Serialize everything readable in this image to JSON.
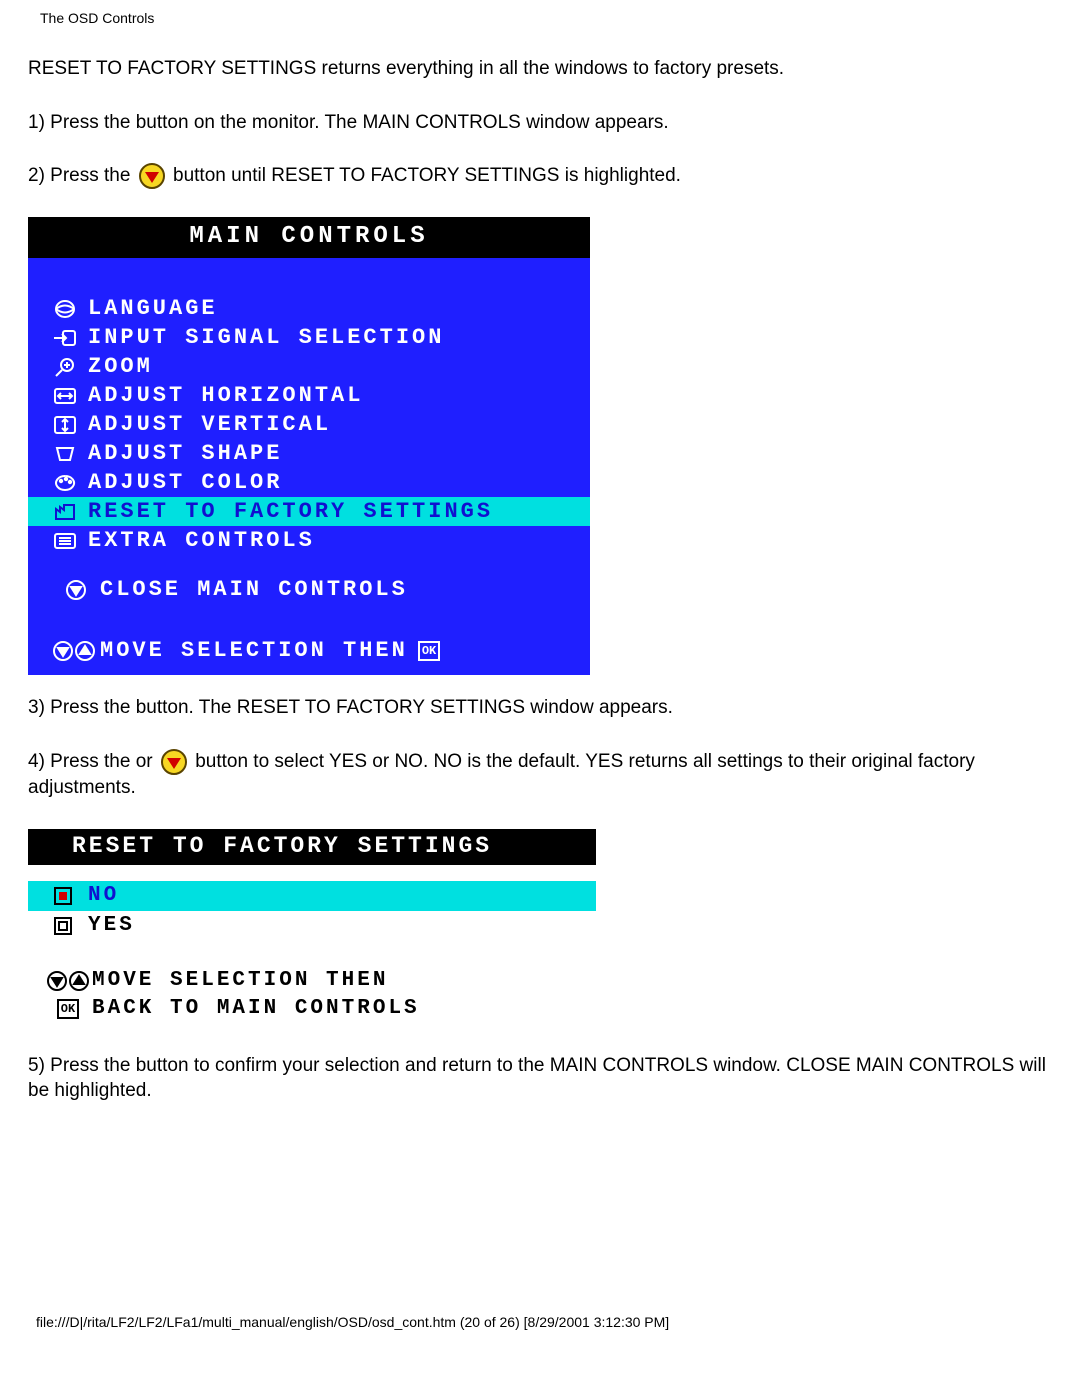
{
  "header": "The OSD Controls",
  "intro": "RESET TO FACTORY SETTINGS returns everything in all the windows to factory presets.",
  "step1_a": "1) Press the ",
  "step1_b": " button on the monitor. The MAIN CONTROLS window appears.",
  "step2_a": "2) Press the ",
  "step2_b": " button until RESET TO FACTORY SETTINGS is highlighted.",
  "osd1": {
    "title": "MAIN CONTROLS",
    "items": [
      "LANGUAGE",
      "INPUT SIGNAL SELECTION",
      "ZOOM",
      "ADJUST HORIZONTAL",
      "ADJUST VERTICAL",
      "ADJUST SHAPE",
      "ADJUST COLOR",
      "RESET TO FACTORY SETTINGS",
      "EXTRA CONTROLS"
    ],
    "close": "CLOSE MAIN CONTROLS",
    "footer_label": "MOVE SELECTION THEN",
    "ok": "OK"
  },
  "step3_a": "3) Press the ",
  "step3_b": " button. The RESET TO FACTORY SETTINGS window appears.",
  "step4_a": "4) Press the ",
  "step4_b": " or ",
  "step4_c": " button to select YES or NO. NO is the default. YES returns all settings to their original factory adjustments.",
  "osd2": {
    "title": "RESET TO FACTORY SETTINGS",
    "no": "NO",
    "yes": "YES",
    "footer1": "MOVE SELECTION THEN",
    "footer2": "BACK TO MAIN CONTROLS",
    "ok": "OK"
  },
  "step5_a": "5) Press the ",
  "step5_b": " button to confirm your selection and return to the MAIN CONTROLS window. CLOSE MAIN CONTROLS will be highlighted.",
  "footer_line": "file:///D|/rita/LF2/LF2/LFa1/multi_manual/english/OSD/osd_cont.htm (20 of 26) [8/29/2001 3:12:30 PM]"
}
